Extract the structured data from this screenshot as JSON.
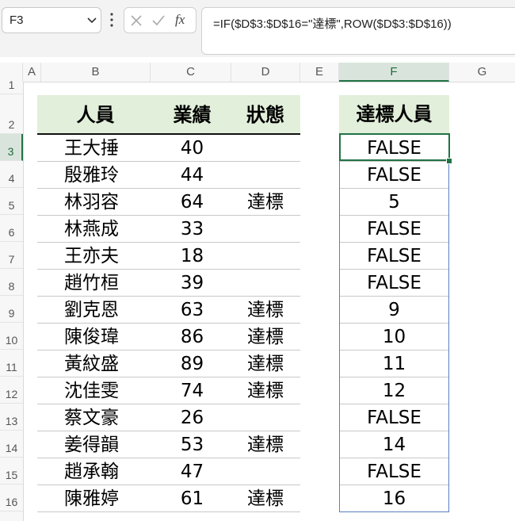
{
  "formula_bar": {
    "name_box": "F3",
    "fx_label": "fx",
    "formula": "=IF($D$3:$D$16=\"達標\",ROW($D$3:$D$16))"
  },
  "columns": [
    "A",
    "B",
    "C",
    "D",
    "E",
    "F",
    "G"
  ],
  "selected_column": "F",
  "row_numbers": [
    "1",
    "2",
    "3",
    "4",
    "5",
    "6",
    "7",
    "8",
    "9",
    "10",
    "11",
    "12",
    "13",
    "14",
    "15",
    "16"
  ],
  "selected_row": "3",
  "table": {
    "headers": [
      "人員",
      "業績",
      "狀態"
    ],
    "rows": [
      {
        "name": "王大捶",
        "score": "40",
        "status": ""
      },
      {
        "name": "殷雅玲",
        "score": "44",
        "status": ""
      },
      {
        "name": "林羽容",
        "score": "64",
        "status": "達標"
      },
      {
        "name": "林燕成",
        "score": "33",
        "status": ""
      },
      {
        "name": "王亦夫",
        "score": "18",
        "status": ""
      },
      {
        "name": "趙竹桓",
        "score": "39",
        "status": ""
      },
      {
        "name": "劉克恩",
        "score": "63",
        "status": "達標"
      },
      {
        "name": "陳俊瑋",
        "score": "86",
        "status": "達標"
      },
      {
        "name": "黃紋盛",
        "score": "89",
        "status": "達標"
      },
      {
        "name": "沈佳雯",
        "score": "74",
        "status": "達標"
      },
      {
        "name": "蔡文豪",
        "score": "26",
        "status": ""
      },
      {
        "name": "姜得韻",
        "score": "53",
        "status": "達標"
      },
      {
        "name": "趙承翰",
        "score": "47",
        "status": ""
      },
      {
        "name": "陳雅婷",
        "score": "61",
        "status": "達標"
      }
    ]
  },
  "result": {
    "header": "達標人員",
    "values": [
      "FALSE",
      "FALSE",
      "5",
      "FALSE",
      "FALSE",
      "FALSE",
      "9",
      "10",
      "11",
      "12",
      "FALSE",
      "14",
      "FALSE",
      "16"
    ]
  },
  "colors": {
    "header_fill": "#e2efda",
    "selection_green": "#217346",
    "spill_border": "#5b7fbf"
  }
}
